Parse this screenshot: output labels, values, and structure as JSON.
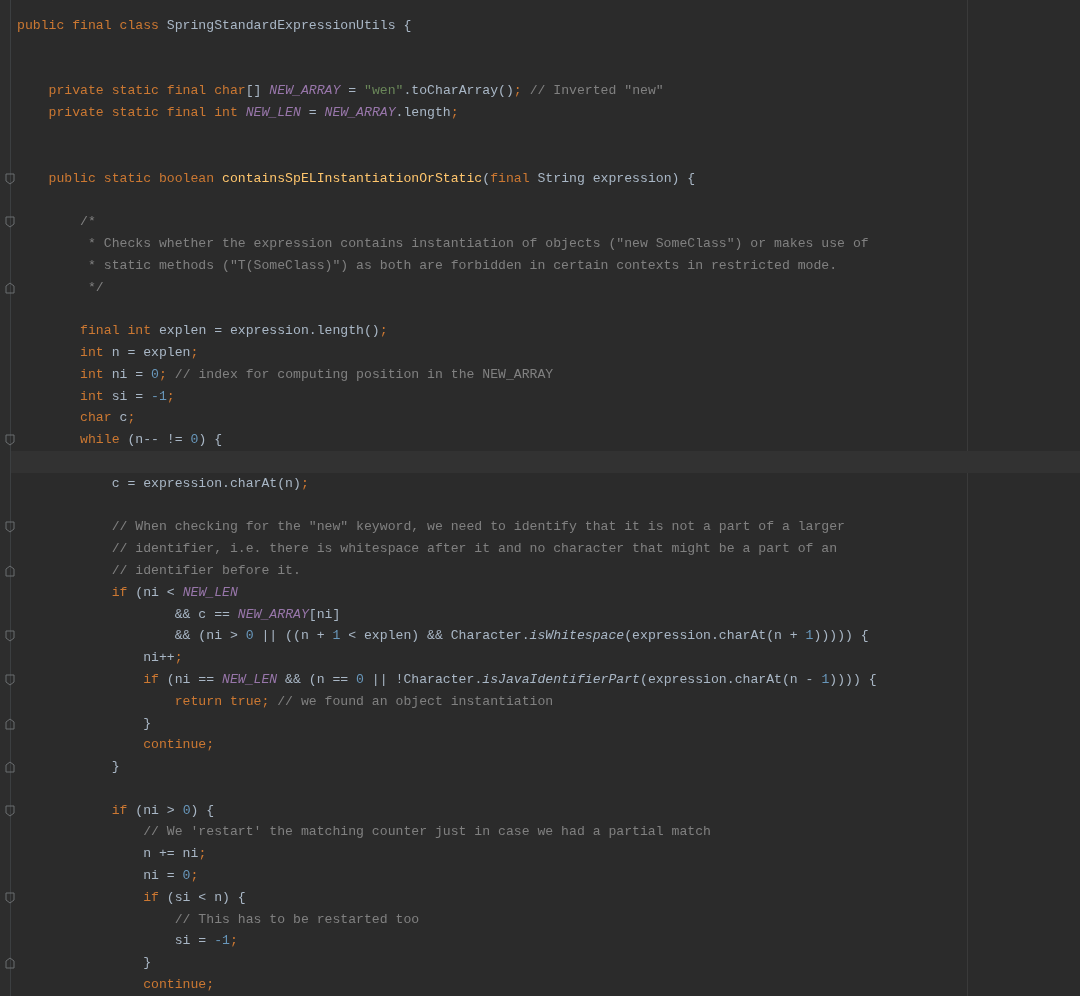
{
  "editor": {
    "lines": [
      {
        "current": false,
        "tokens": [
          {
            "text": "public final class ",
            "kind": "keyword"
          },
          {
            "text": "SpringStandardExpressionUtils {",
            "kind": "plain"
          }
        ]
      },
      {
        "current": false
      },
      {
        "current": false
      },
      {
        "current": false,
        "tokens": [
          {
            "text": "    private static final char",
            "kind": "keyword"
          },
          {
            "text": "[] ",
            "kind": "plain"
          },
          {
            "text": "NEW_ARRAY",
            "kind": "constant"
          },
          {
            "text": " = ",
            "kind": "plain"
          },
          {
            "text": "\"wen\"",
            "kind": "string"
          },
          {
            "text": ".toCharArray()",
            "kind": "plain"
          },
          {
            "text": ";",
            "kind": "keyword"
          },
          {
            "text": " // Inverted \"new\"",
            "kind": "comment"
          }
        ]
      },
      {
        "current": false,
        "tokens": [
          {
            "text": "    private static final int ",
            "kind": "keyword"
          },
          {
            "text": "NEW_LEN",
            "kind": "constant"
          },
          {
            "text": " = ",
            "kind": "plain"
          },
          {
            "text": "NEW_ARRAY",
            "kind": "constant"
          },
          {
            "text": ".length",
            "kind": "plain"
          },
          {
            "text": ";",
            "kind": "keyword"
          }
        ]
      },
      {
        "current": false
      },
      {
        "current": false
      },
      {
        "current": false,
        "fold": {
          "end": false
        },
        "tokens": [
          {
            "text": "    public static boolean ",
            "kind": "keyword"
          },
          {
            "text": "containsSpELInstantiationOrStatic",
            "kind": "declaration"
          },
          {
            "text": "(",
            "kind": "plain"
          },
          {
            "text": "final ",
            "kind": "keyword"
          },
          {
            "text": "String expression) {",
            "kind": "plain"
          }
        ]
      },
      {
        "current": false
      },
      {
        "current": false,
        "fold": {
          "end": false
        },
        "tokens": [
          {
            "text": "        /*",
            "kind": "comment"
          }
        ]
      },
      {
        "current": false,
        "tokens": [
          {
            "text": "         * Checks whether the expression contains instantiation of objects (\"new SomeClass\") or makes use of",
            "kind": "comment"
          }
        ]
      },
      {
        "current": false,
        "tokens": [
          {
            "text": "         * static methods (\"T(SomeClass)\") as both are forbidden in certain contexts in restricted mode.",
            "kind": "comment"
          }
        ]
      },
      {
        "current": false,
        "fold": {
          "end": true
        },
        "tokens": [
          {
            "text": "         */",
            "kind": "comment"
          }
        ]
      },
      {
        "current": false
      },
      {
        "current": false,
        "tokens": [
          {
            "text": "        final int ",
            "kind": "keyword"
          },
          {
            "text": "explen = expression.length()",
            "kind": "plain"
          },
          {
            "text": ";",
            "kind": "keyword"
          }
        ]
      },
      {
        "current": false,
        "tokens": [
          {
            "text": "        int ",
            "kind": "keyword"
          },
          {
            "text": "n = explen",
            "kind": "plain"
          },
          {
            "text": ";",
            "kind": "keyword"
          }
        ]
      },
      {
        "current": false,
        "tokens": [
          {
            "text": "        int ",
            "kind": "keyword"
          },
          {
            "text": "ni = ",
            "kind": "plain"
          },
          {
            "text": "0",
            "kind": "number"
          },
          {
            "text": ";",
            "kind": "keyword"
          },
          {
            "text": " // index for computing position in the NEW_ARRAY",
            "kind": "comment"
          }
        ]
      },
      {
        "current": false,
        "tokens": [
          {
            "text": "        int ",
            "kind": "keyword"
          },
          {
            "text": "si = ",
            "kind": "plain"
          },
          {
            "text": "-1",
            "kind": "number"
          },
          {
            "text": ";",
            "kind": "keyword"
          }
        ]
      },
      {
        "current": false,
        "tokens": [
          {
            "text": "        char ",
            "kind": "keyword"
          },
          {
            "text": "c",
            "kind": "plain"
          },
          {
            "text": ";",
            "kind": "keyword"
          }
        ]
      },
      {
        "current": false,
        "fold": {
          "end": false
        },
        "tokens": [
          {
            "text": "        while ",
            "kind": "keyword"
          },
          {
            "text": "(n-- != ",
            "kind": "plain"
          },
          {
            "text": "0",
            "kind": "number"
          },
          {
            "text": ") {",
            "kind": "plain"
          }
        ]
      },
      {
        "current": true
      },
      {
        "current": false,
        "tokens": [
          {
            "text": "            c = expression.charAt(n)",
            "kind": "plain"
          },
          {
            "text": ";",
            "kind": "keyword"
          }
        ]
      },
      {
        "current": false
      },
      {
        "current": false,
        "fold": {
          "end": false
        },
        "tokens": [
          {
            "text": "            // When checking for the \"new\" keyword, we need to identify that it is not a part of a larger",
            "kind": "comment"
          }
        ]
      },
      {
        "current": false,
        "tokens": [
          {
            "text": "            // identifier, i.e. there is whitespace after it and no character that might be a part of an",
            "kind": "comment"
          }
        ]
      },
      {
        "current": false,
        "fold": {
          "end": true
        },
        "tokens": [
          {
            "text": "            // identifier before it.",
            "kind": "comment"
          }
        ]
      },
      {
        "current": false,
        "tokens": [
          {
            "text": "            if ",
            "kind": "keyword"
          },
          {
            "text": "(ni < ",
            "kind": "plain"
          },
          {
            "text": "NEW_LEN",
            "kind": "constant"
          }
        ]
      },
      {
        "current": false,
        "tokens": [
          {
            "text": "                    && c == ",
            "kind": "plain"
          },
          {
            "text": "NEW_ARRAY",
            "kind": "constant"
          },
          {
            "text": "[ni]",
            "kind": "plain"
          }
        ]
      },
      {
        "current": false,
        "fold": {
          "end": false
        },
        "tokens": [
          {
            "text": "                    && (ni > ",
            "kind": "plain"
          },
          {
            "text": "0",
            "kind": "number"
          },
          {
            "text": " || ((n + ",
            "kind": "plain"
          },
          {
            "text": "1",
            "kind": "number"
          },
          {
            "text": " < explen) && Character.",
            "kind": "plain"
          },
          {
            "text": "isWhitespace",
            "kind": "static"
          },
          {
            "text": "(expression.charAt(n + ",
            "kind": "plain"
          },
          {
            "text": "1",
            "kind": "number"
          },
          {
            "text": "))))) {",
            "kind": "plain"
          }
        ]
      },
      {
        "current": false,
        "tokens": [
          {
            "text": "                ni++",
            "kind": "plain"
          },
          {
            "text": ";",
            "kind": "keyword"
          }
        ]
      },
      {
        "current": false,
        "fold": {
          "end": false
        },
        "tokens": [
          {
            "text": "                if ",
            "kind": "keyword"
          },
          {
            "text": "(ni == ",
            "kind": "plain"
          },
          {
            "text": "NEW_LEN",
            "kind": "constant"
          },
          {
            "text": " && (n == ",
            "kind": "plain"
          },
          {
            "text": "0",
            "kind": "number"
          },
          {
            "text": " || !Character.",
            "kind": "plain"
          },
          {
            "text": "isJavaIdentifierPart",
            "kind": "static"
          },
          {
            "text": "(expression.charAt(n - ",
            "kind": "plain"
          },
          {
            "text": "1",
            "kind": "number"
          },
          {
            "text": ")))) {",
            "kind": "plain"
          }
        ]
      },
      {
        "current": false,
        "tokens": [
          {
            "text": "                    return true;",
            "kind": "keyword"
          },
          {
            "text": " // we found an object instantiation",
            "kind": "comment"
          }
        ]
      },
      {
        "current": false,
        "fold": {
          "end": true
        },
        "tokens": [
          {
            "text": "                }",
            "kind": "plain"
          }
        ]
      },
      {
        "current": false,
        "tokens": [
          {
            "text": "                continue;",
            "kind": "keyword"
          }
        ]
      },
      {
        "current": false,
        "fold": {
          "end": true
        },
        "tokens": [
          {
            "text": "            }",
            "kind": "plain"
          }
        ]
      },
      {
        "current": false
      },
      {
        "current": false,
        "fold": {
          "end": false
        },
        "tokens": [
          {
            "text": "            if ",
            "kind": "keyword"
          },
          {
            "text": "(ni > ",
            "kind": "plain"
          },
          {
            "text": "0",
            "kind": "number"
          },
          {
            "text": ") {",
            "kind": "plain"
          }
        ]
      },
      {
        "current": false,
        "tokens": [
          {
            "text": "                // We 'restart' the matching counter just in case we had a partial match",
            "kind": "comment"
          }
        ]
      },
      {
        "current": false,
        "tokens": [
          {
            "text": "                n += ni",
            "kind": "plain"
          },
          {
            "text": ";",
            "kind": "keyword"
          }
        ]
      },
      {
        "current": false,
        "tokens": [
          {
            "text": "                ni = ",
            "kind": "plain"
          },
          {
            "text": "0",
            "kind": "number"
          },
          {
            "text": ";",
            "kind": "keyword"
          }
        ]
      },
      {
        "current": false,
        "fold": {
          "end": false
        },
        "tokens": [
          {
            "text": "                if ",
            "kind": "keyword"
          },
          {
            "text": "(si < n) {",
            "kind": "plain"
          }
        ]
      },
      {
        "current": false,
        "tokens": [
          {
            "text": "                    // This has to be restarted too",
            "kind": "comment"
          }
        ]
      },
      {
        "current": false,
        "tokens": [
          {
            "text": "                    si = ",
            "kind": "plain"
          },
          {
            "text": "-1",
            "kind": "number"
          },
          {
            "text": ";",
            "kind": "keyword"
          }
        ]
      },
      {
        "current": false,
        "fold": {
          "end": true
        },
        "tokens": [
          {
            "text": "                }",
            "kind": "plain"
          }
        ]
      },
      {
        "current": false,
        "tokens": [
          {
            "text": "                continue;",
            "kind": "keyword"
          }
        ]
      }
    ]
  }
}
